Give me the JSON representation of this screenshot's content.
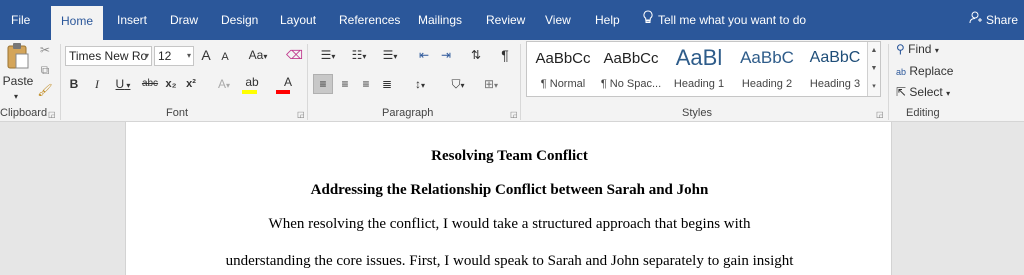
{
  "tabs": [
    "File",
    "Home",
    "Insert",
    "Draw",
    "Design",
    "Layout",
    "References",
    "Mailings",
    "Review",
    "View",
    "Help"
  ],
  "tell_me": "Tell me what you want to do",
  "share": "Share",
  "clipboard": {
    "paste": "Paste",
    "label": "Clipboard"
  },
  "font": {
    "name": "Times New Ro",
    "size": "12",
    "label": "Font",
    "grow": "A",
    "shrink": "A",
    "case": "Aa",
    "bold": "B",
    "italic": "I",
    "underline": "U",
    "strike": "abc",
    "sub": "x₂",
    "sup": "x²"
  },
  "paragraph": {
    "label": "Paragraph",
    "pilcrow": "¶"
  },
  "styles": {
    "label": "Styles",
    "items": [
      {
        "preview": "AaBbCc",
        "name": "¶ Normal"
      },
      {
        "preview": "AaBbCc",
        "name": "¶ No Spac..."
      },
      {
        "preview": "AaBl",
        "name": "Heading 1"
      },
      {
        "preview": "AaBbC",
        "name": "Heading 2"
      },
      {
        "preview": "AaBbC",
        "name": "Heading 3"
      }
    ]
  },
  "editing": {
    "find": "Find",
    "replace": "Replace",
    "select": "Select",
    "label": "Editing"
  },
  "document": {
    "title": "Resolving Team Conflict",
    "subtitle": "Addressing the Relationship Conflict between Sarah and John",
    "line1": "When resolving the conflict, I would take a structured approach that begins with",
    "line2": "understanding the core issues. First, I would speak to Sarah and John separately to gain insight"
  },
  "colors": {
    "accent": "#2b579a",
    "highlight": "#ffff00",
    "font_color": "#ff0000"
  }
}
